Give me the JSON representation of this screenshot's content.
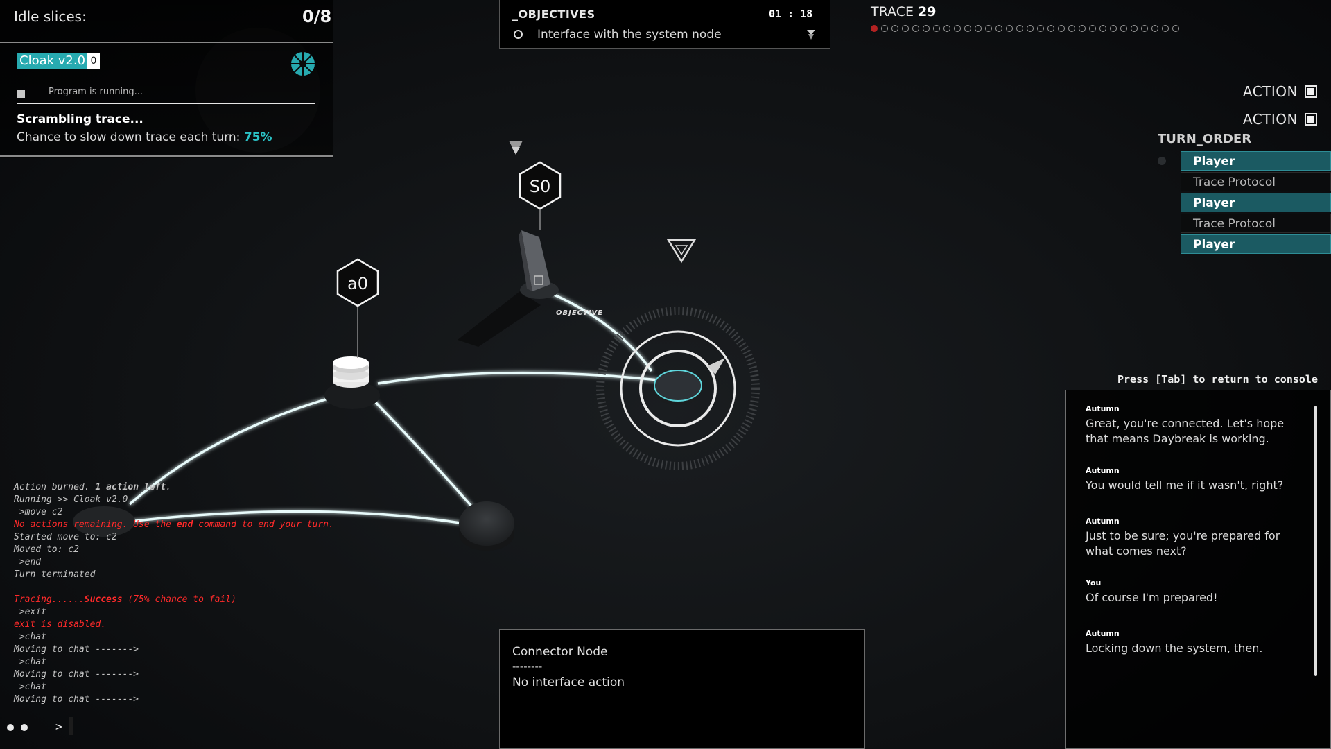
{
  "idle": {
    "label": "Idle slices:",
    "value": "0/8"
  },
  "program": {
    "name": "Cloak v2.0",
    "count": "0",
    "status": "Program is running...",
    "title": "Scrambling trace...",
    "desc": "Chance to slow down trace each turn:",
    "pct": "75%"
  },
  "objectives": {
    "title": "_OBJECTIVES",
    "timer": "01 : 18",
    "item": "Interface with the system node"
  },
  "trace": {
    "label": "TRACE",
    "value": "29",
    "dots_total": 30,
    "dots_active": 1
  },
  "actions": [
    "ACTION",
    "ACTION"
  ],
  "turn_order": {
    "title": "TURN_ORDER",
    "items": [
      {
        "label": "Player",
        "kind": "player"
      },
      {
        "label": "Trace Protocol",
        "kind": "trace"
      },
      {
        "label": "Player",
        "kind": "player"
      },
      {
        "label": "Trace Protocol",
        "kind": "trace"
      },
      {
        "label": "Player",
        "kind": "player"
      }
    ]
  },
  "map": {
    "node_a0": "a0",
    "node_s0": "S0",
    "objective_label": "OBJECTIVE"
  },
  "chat": {
    "hint": "Press [Tab] to return to console",
    "messages": [
      {
        "author": "Autumn",
        "text": "Great, you're connected. Let's hope that means Daybreak is working."
      },
      {
        "author": "Autumn",
        "text": "You would tell me if it wasn't, right?"
      },
      {
        "author": "Autumn",
        "text": "Just to be sure; you're prepared for what comes next?"
      },
      {
        "author": "You",
        "text": "Of course I'm prepared!"
      },
      {
        "author": "Autumn",
        "text": "Locking down the system, then."
      }
    ]
  },
  "console": {
    "lines": [
      {
        "segments": [
          {
            "t": "Action burned. "
          },
          {
            "t": "1 action left",
            "b": true
          },
          {
            "t": "."
          }
        ]
      },
      {
        "segments": [
          {
            "t": "Running >> Cloak v2.0"
          }
        ]
      },
      {
        "segments": [
          {
            "t": " >move c2"
          }
        ]
      },
      {
        "red": true,
        "segments": [
          {
            "t": "No actions remaining. Use the "
          },
          {
            "t": "end",
            "b": true
          },
          {
            "t": " command to end your turn."
          }
        ]
      },
      {
        "segments": [
          {
            "t": "Started move to: c2"
          }
        ]
      },
      {
        "segments": [
          {
            "t": "Moved to: c2"
          }
        ]
      },
      {
        "segments": [
          {
            "t": " >end"
          }
        ]
      },
      {
        "segments": [
          {
            "t": "Turn terminated"
          }
        ]
      },
      {
        "segments": [
          {
            "t": " "
          }
        ]
      },
      {
        "red": true,
        "segments": [
          {
            "t": "Tracing......"
          },
          {
            "t": "Success",
            "b": true
          },
          {
            "t": " (75% chance to fail)"
          }
        ]
      },
      {
        "segments": [
          {
            "t": " >exit"
          }
        ]
      },
      {
        "red": true,
        "segments": [
          {
            "t": "exit is disabled."
          }
        ]
      },
      {
        "segments": [
          {
            "t": " >chat"
          }
        ]
      },
      {
        "segments": [
          {
            "t": "Moving to chat ------->"
          }
        ]
      },
      {
        "segments": [
          {
            "t": " >chat"
          }
        ]
      },
      {
        "segments": [
          {
            "t": "Moving to chat ------->"
          }
        ]
      },
      {
        "segments": [
          {
            "t": " >chat"
          }
        ]
      },
      {
        "segments": [
          {
            "t": "Moving to chat ------->"
          }
        ]
      }
    ],
    "prompt": ">"
  },
  "info": {
    "title": "Connector Node",
    "separator": "--------",
    "action": "No interface action"
  },
  "colors": {
    "accent": "#27aab0",
    "danger": "#ff2a2a",
    "trace_active": "#b32222"
  }
}
